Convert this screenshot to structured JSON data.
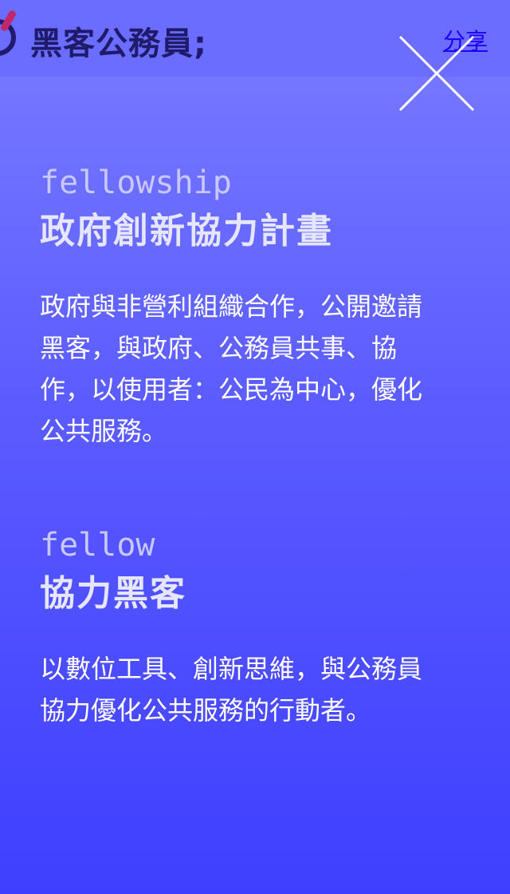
{
  "header": {
    "site_title": "黑客公務員;",
    "share_label": "分享",
    "close_icon": "close-x-icon"
  },
  "sections": [
    {
      "kicker": "fellowship",
      "heading": "政府創新協力計畫",
      "description": "政府與非營利組織合作，公開邀請黑客，與政府、公務員共事、協作，以使用者：公民為中心，優化公共服務。"
    },
    {
      "kicker": "fellow",
      "heading": "協力黑客",
      "description": "以數位工具、創新思維，與公務員協力優化公共服務的行動者。"
    }
  ],
  "colors": {
    "background_top": "#7a7dff",
    "background_bottom": "#3f3fff",
    "title_color": "#1f1a6a",
    "share_link_color": "#1e00ff",
    "logo_accent": "#c0286a"
  }
}
